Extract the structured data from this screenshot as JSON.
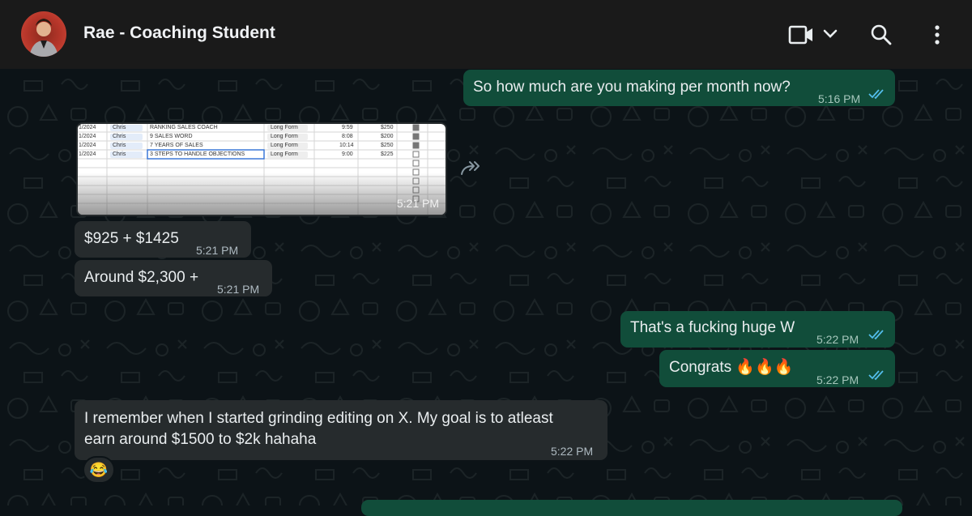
{
  "header": {
    "contact_name": "Rae - Coaching Student",
    "icons": [
      "video-call-icon",
      "chevron-down-icon",
      "search-icon",
      "menu-dots-icon"
    ]
  },
  "colors": {
    "background": "#0c1317",
    "header": "#1a1a1a",
    "outgoing_bubble": "#114d3a",
    "incoming_bubble": "#262b2d",
    "read_ticks": "#53bdeb"
  },
  "messages": [
    {
      "id": "m1",
      "direction": "out",
      "text": "So how much are you making per month now?",
      "time": "5:16 PM",
      "status": "read"
    },
    {
      "id": "m2",
      "direction": "in",
      "type": "image",
      "time": "5:21 PM",
      "image_table": {
        "rows": [
          {
            "date": "1/2024",
            "editor": "Chris",
            "title": "RANKING SALES COACH",
            "format": "Long Form",
            "length": "9:59",
            "price": "$250",
            "checked": true
          },
          {
            "date": "1/2024",
            "editor": "Chris",
            "title": "9 SALES WORD",
            "format": "Long Form",
            "length": "8:08",
            "price": "$200",
            "checked": true
          },
          {
            "date": "1/2024",
            "editor": "Chris",
            "title": "7 YEARS OF SALES",
            "format": "Long Form",
            "length": "10:14",
            "price": "$250",
            "checked": true
          },
          {
            "date": "1/2024",
            "editor": "Chris",
            "title": "3 STEPS TO HANDLE OBJECTIONS",
            "format": "Long Form",
            "length": "9:00",
            "price": "$225",
            "checked": false
          }
        ]
      }
    },
    {
      "id": "m3",
      "direction": "in",
      "text": "$925 + $1425",
      "time": "5:21 PM"
    },
    {
      "id": "m4",
      "direction": "in",
      "text": "Around $2,300 +",
      "time": "5:21 PM"
    },
    {
      "id": "m5",
      "direction": "out",
      "text": "That's a fucking huge W",
      "time": "5:22 PM",
      "status": "read"
    },
    {
      "id": "m6",
      "direction": "out",
      "text": "Congrats 🔥🔥🔥",
      "time": "5:22 PM",
      "status": "read"
    },
    {
      "id": "m7",
      "direction": "in",
      "text_line1": "I remember when I started grinding editing on X. My goal is to atleast",
      "text_line2": "earn around $1500 to $2k hahaha",
      "time": "5:22 PM",
      "reaction": "😂"
    }
  ]
}
